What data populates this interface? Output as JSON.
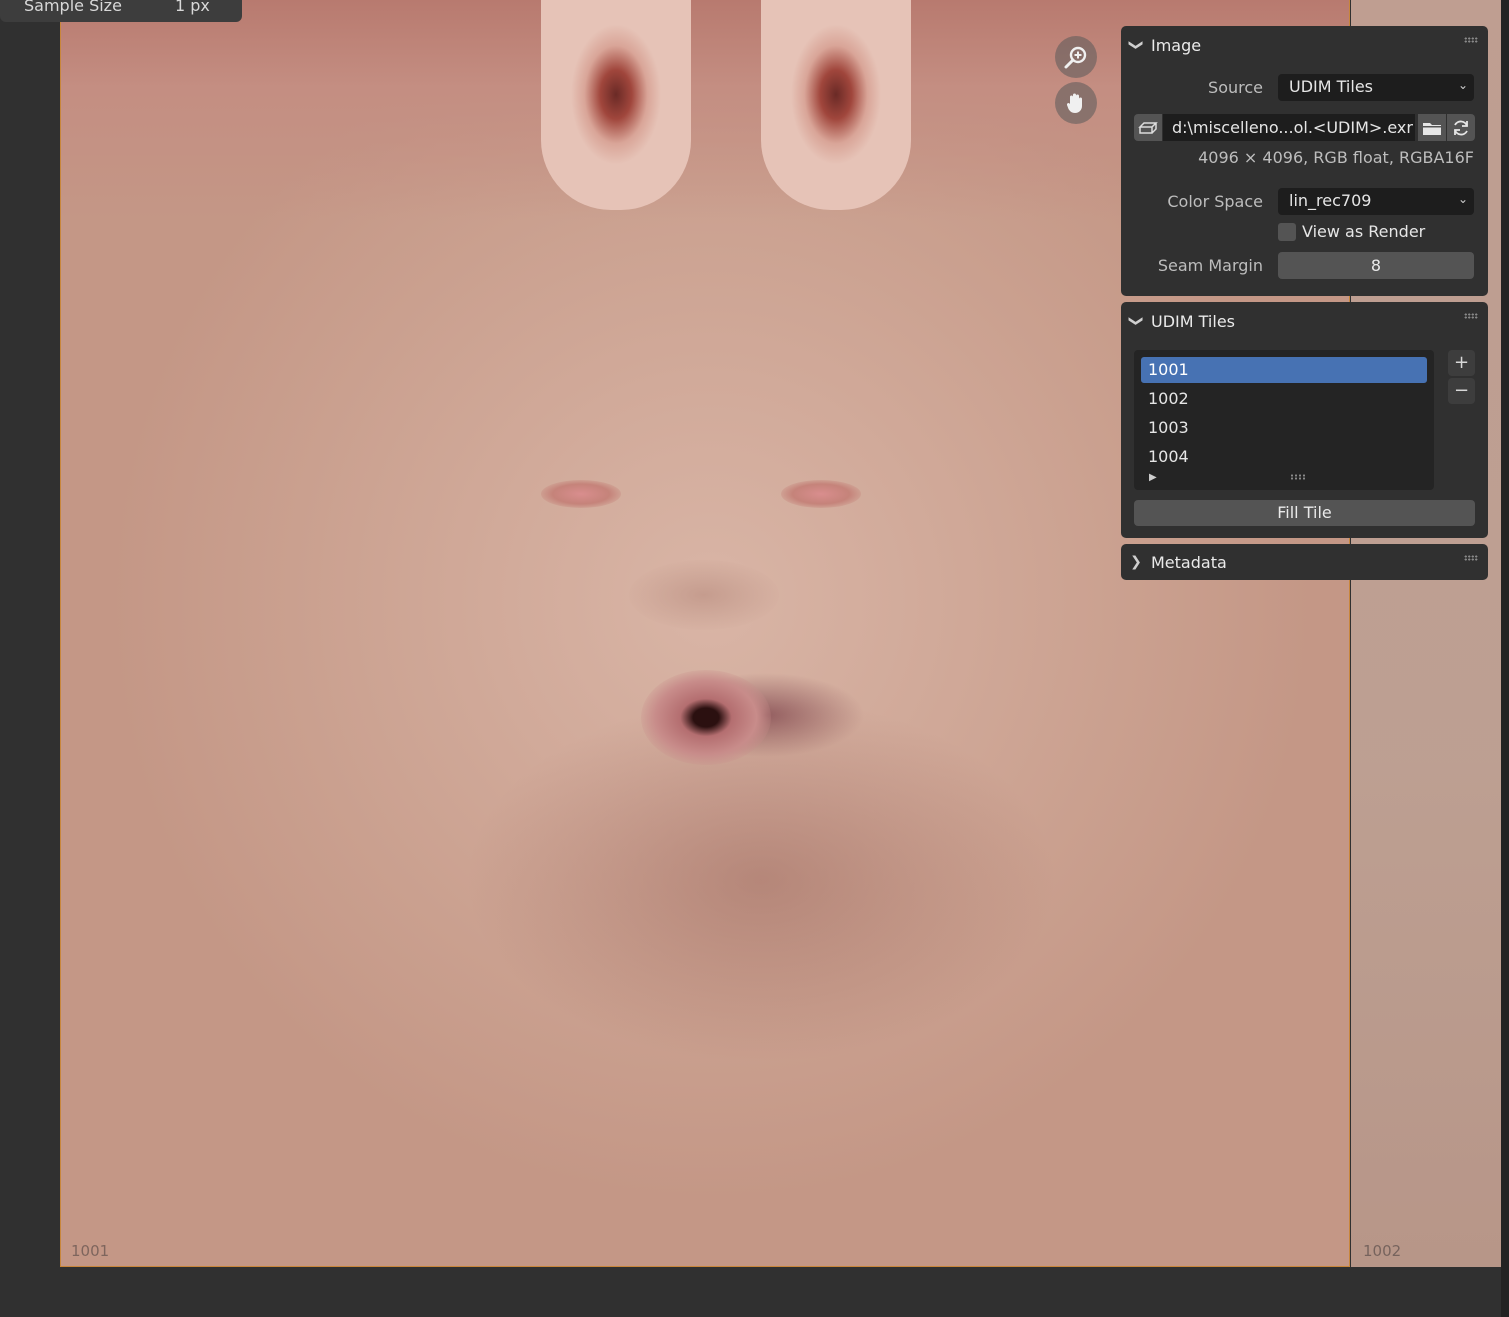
{
  "header": {
    "sample_size_label": "Sample Size",
    "sample_size_value": "1 px"
  },
  "viewport": {
    "tile_labels": [
      "1001",
      "1002"
    ],
    "nav_icons": [
      "zoom-icon",
      "hand-pan-icon"
    ]
  },
  "image_panel": {
    "title": "Image",
    "source_label": "Source",
    "source_value": "UDIM Tiles",
    "filepath": "d:\\miscelleno...ol.<UDIM>.exr",
    "info": "4096 × 4096,  RGB float, RGBA16F",
    "color_space_label": "Color Space",
    "color_space_value": "lin_rec709",
    "view_as_render_label": "View as Render",
    "view_as_render_checked": false,
    "seam_margin_label": "Seam Margin",
    "seam_margin_value": "8"
  },
  "udim_panel": {
    "title": "UDIM Tiles",
    "tiles": [
      "1001",
      "1002",
      "1003",
      "1004"
    ],
    "selected_tile": "1001",
    "add_label": "+",
    "remove_label": "−",
    "fill_tile_label": "Fill Tile"
  },
  "metadata_panel": {
    "title": "Metadata"
  },
  "colors": {
    "accent": "#4772b3",
    "tile_border": "#c9863a",
    "panel_bg": "#303030",
    "field_bg": "#1d1d1d"
  }
}
